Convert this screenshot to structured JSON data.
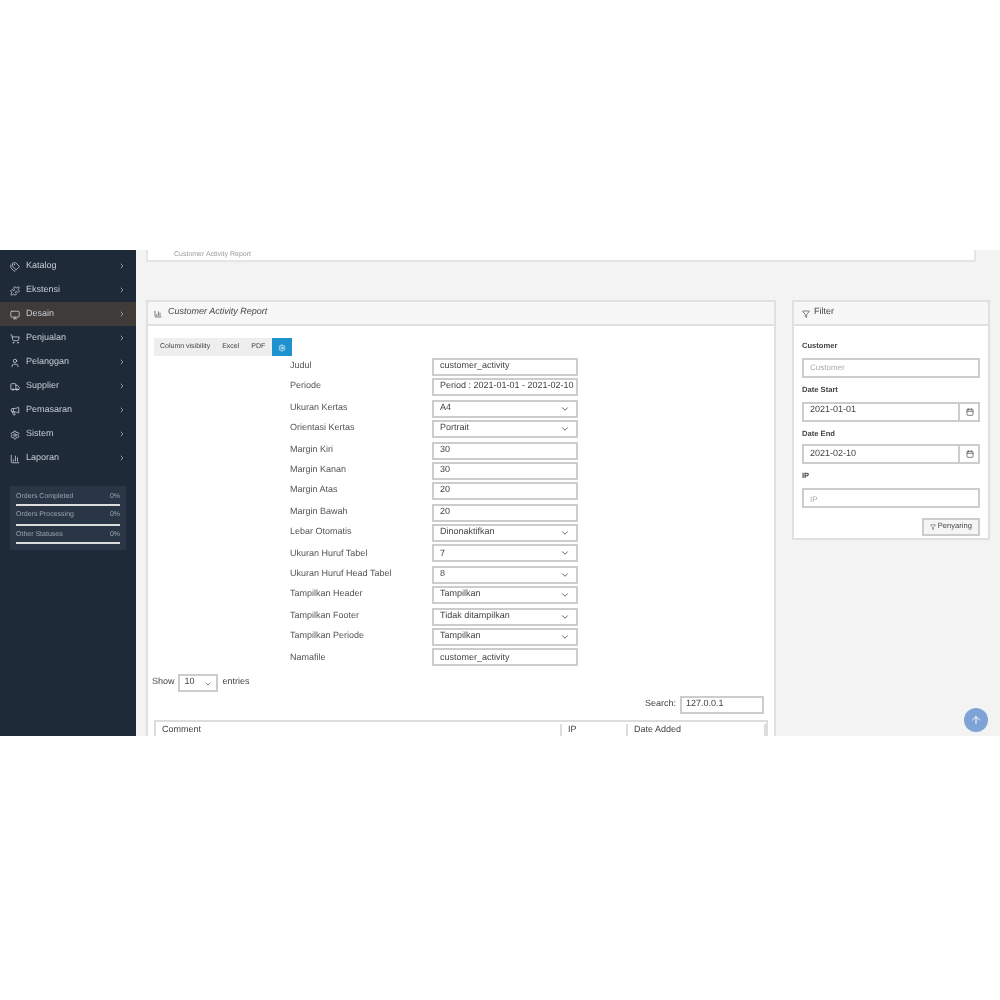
{
  "sidebar": {
    "items": [
      {
        "label": "Katalog",
        "selected": false
      },
      {
        "label": "Ekstensi",
        "selected": false
      },
      {
        "label": "Desain",
        "selected": true
      },
      {
        "label": "Penjualan",
        "selected": false
      },
      {
        "label": "Pelanggan",
        "selected": false
      },
      {
        "label": "Supplier",
        "selected": false
      },
      {
        "label": "Pemasaran",
        "selected": false
      },
      {
        "label": "Sistem",
        "selected": false
      },
      {
        "label": "Laporan",
        "selected": false
      }
    ],
    "stats": [
      {
        "label": "Orders Completed",
        "value": "0%"
      },
      {
        "label": "Orders Processing",
        "value": "0%"
      },
      {
        "label": "Other Statuses",
        "value": "0%"
      }
    ]
  },
  "breadcrumb": "Customer Activity Report",
  "report": {
    "title": "Customer Activity Report",
    "buttons": [
      {
        "label": "Column visibility",
        "kind": "text"
      },
      {
        "label": "Excel",
        "kind": "text"
      },
      {
        "label": "PDF",
        "kind": "text"
      },
      {
        "kind": "gear"
      }
    ],
    "fields": [
      {
        "label": "Judul",
        "kind": "input",
        "value": "customer_activity"
      },
      {
        "label": "Periode",
        "kind": "input",
        "value": "Period : 2021-01-01 - 2021-02-10"
      },
      {
        "label": "Ukuran Kertas",
        "kind": "select",
        "value": "A4"
      },
      {
        "label": "Orientasi Kertas",
        "kind": "select",
        "value": "Portrait"
      },
      {
        "label": "Margin Kiri",
        "kind": "input",
        "value": "30"
      },
      {
        "label": "Margin Kanan",
        "kind": "input",
        "value": "30"
      },
      {
        "label": "Margin Atas",
        "kind": "input",
        "value": "20"
      },
      {
        "label": "Margin Bawah",
        "kind": "input",
        "value": "20"
      },
      {
        "label": "Lebar Otomatis",
        "kind": "select",
        "value": "Dinonaktifkan"
      },
      {
        "label": "Ukuran Huruf Tabel",
        "kind": "select",
        "value": "7"
      },
      {
        "label": "Ukuran Huruf Head Tabel",
        "kind": "select",
        "value": "8"
      },
      {
        "label": "Tampilkan Header",
        "kind": "select",
        "value": "Tampilkan"
      },
      {
        "label": "Tampilkan Footer",
        "kind": "select",
        "value": "Tidak ditampilkan"
      },
      {
        "label": "Tampilkan Periode",
        "kind": "select",
        "value": "Tampilkan"
      },
      {
        "label": "Namafile",
        "kind": "input",
        "value": "customer_activity"
      }
    ],
    "show_label": "Show",
    "show_value": "10",
    "entries_label": "entries",
    "search_label": "Search:",
    "search_value": "127.0.0.1",
    "columns": [
      "Comment",
      "IP",
      "Date Added"
    ]
  },
  "filter": {
    "title": "Filter",
    "fields": [
      {
        "label": "Customer",
        "placeholder": "Customer",
        "kind": "text"
      },
      {
        "label": "Date Start",
        "value": "2021-01-01",
        "kind": "date"
      },
      {
        "label": "Date End",
        "value": "2021-02-10",
        "kind": "date"
      },
      {
        "label": "IP",
        "placeholder": "IP",
        "kind": "text"
      }
    ],
    "button": "Penyaring"
  }
}
